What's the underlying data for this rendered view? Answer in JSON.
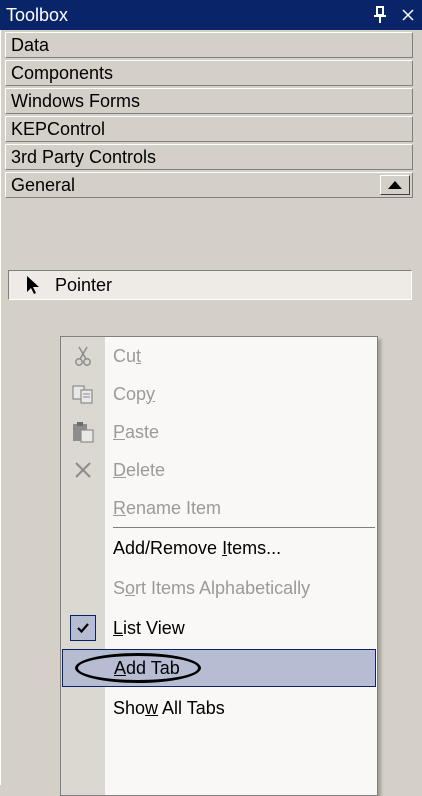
{
  "titlebar": {
    "title": "Toolbox",
    "pin_glyph": "↕",
    "close_glyph": "×"
  },
  "tabs": [
    {
      "label": "Data"
    },
    {
      "label": "Components"
    },
    {
      "label": "Windows Forms"
    },
    {
      "label": "KEPControl"
    },
    {
      "label": "3rd Party Controls"
    },
    {
      "label": "General"
    }
  ],
  "tool_item": {
    "label": "Pointer",
    "icon": "pointer-icon"
  },
  "context_menu": {
    "items": [
      {
        "pre": "Cu",
        "key": "t",
        "post": "",
        "icon": "cut-icon",
        "enabled": false
      },
      {
        "pre": "Cop",
        "key": "y",
        "post": "",
        "icon": "copy-icon",
        "enabled": false
      },
      {
        "pre": "",
        "key": "P",
        "post": "aste",
        "icon": "paste-icon",
        "enabled": false
      },
      {
        "pre": "",
        "key": "D",
        "post": "elete",
        "icon": "delete-icon",
        "enabled": false
      },
      {
        "pre": "",
        "key": "R",
        "post": "ename Item",
        "icon": "",
        "enabled": false
      },
      {
        "pre": "Add/Remove ",
        "key": "I",
        "post": "tems...",
        "icon": "",
        "enabled": true
      },
      {
        "pre": "S",
        "key": "o",
        "post": "rt Items Alphabetically",
        "icon": "",
        "enabled": false
      },
      {
        "pre": "",
        "key": "L",
        "post": "ist View",
        "icon": "check-icon",
        "enabled": true,
        "checked": true
      },
      {
        "pre": "",
        "key": "A",
        "post": "dd Tab",
        "icon": "",
        "enabled": true,
        "highlighted": true
      },
      {
        "pre": "Sho",
        "key": "w",
        "post": " All Tabs",
        "icon": "",
        "enabled": true
      }
    ]
  },
  "colors": {
    "titlebar_bg": "#0a246a",
    "panel_bg": "#d4d0c8",
    "menu_bg": "#f9f8f7",
    "highlight_bg": "#b6bdd2"
  }
}
